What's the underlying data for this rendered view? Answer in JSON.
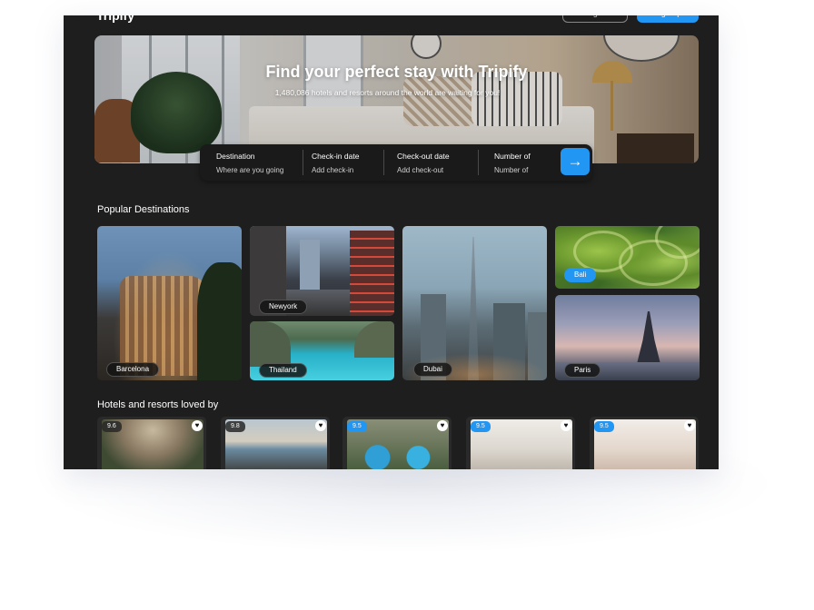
{
  "nav": {
    "logo": "Tripify",
    "login_label": "Log in",
    "signup_label": "Sign up"
  },
  "hero": {
    "title": "Find your perfect stay with Tripify",
    "subtitle": "1,480,086 hotels and resorts around the world are waiting for you!"
  },
  "search": {
    "fields": [
      {
        "label": "Destination",
        "placeholder": "Where are you going"
      },
      {
        "label": "Check-in date",
        "placeholder": "Add check-in"
      },
      {
        "label": "Check-out date",
        "placeholder": "Add check-out"
      },
      {
        "label": "Number of",
        "placeholder": "Number of"
      }
    ],
    "submit_icon": "arrow-right-icon"
  },
  "popular": {
    "title": "Popular Destinations",
    "destinations": [
      {
        "name": "Barcelona"
      },
      {
        "name": "Newyork"
      },
      {
        "name": "Thailand"
      },
      {
        "name": "Dubai"
      },
      {
        "name": "Bali"
      },
      {
        "name": "Paris"
      }
    ]
  },
  "hotels": {
    "title": "Hotels and resorts loved by",
    "cards": [
      {
        "rating": "9.6"
      },
      {
        "rating": "9.8"
      },
      {
        "rating": "9.5"
      },
      {
        "rating": "9.5"
      },
      {
        "rating": "9.5"
      }
    ]
  },
  "colors": {
    "accent": "#2196f3",
    "background": "#1e1e1e"
  }
}
